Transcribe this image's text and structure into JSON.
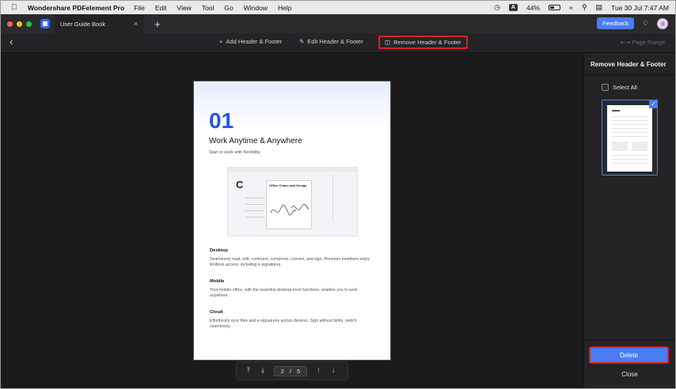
{
  "menubar": {
    "app_name": "Wondershare PDFelement Pro",
    "items": [
      "File",
      "Edit",
      "View",
      "Tool",
      "Go",
      "Window",
      "Help"
    ],
    "input_badge": "A",
    "battery": "44%",
    "datetime": "Tue 30 Jul  7:47 AM"
  },
  "tabbar": {
    "tab_title": "User Guide Book",
    "feedback_label": "Feedback",
    "traffic_colors": [
      "#ff5f57",
      "#febc2e",
      "#28c840"
    ]
  },
  "toolbar": {
    "add_label": "Add Header & Footer",
    "edit_label": "Edit Header & Footer",
    "remove_label": "Remove Header & Footer",
    "page_range_label": "Page Range"
  },
  "document": {
    "chapter_number": "01",
    "title": "Work Anytime & Anywhere",
    "subtitle": "Start to work with flexibility.",
    "screenshot_heading": "Office Chairs and Design",
    "screenshot_letter": "C",
    "sections": [
      {
        "heading": "Desktop",
        "text": "Seamlessly read, edit, comment, compress, convert, and sign. Premium members enjoy limitless access, including e-signatures."
      },
      {
        "heading": "Mobile",
        "text": "Your mobile office, with the essential desktop-level functions, enables you to work anywhere."
      },
      {
        "heading": "Cloud",
        "text": "Effortlessly sync files and e-signatures across devices. Sign without limits, switch seamlessly."
      }
    ]
  },
  "pagination": {
    "current": "2",
    "separator": "/",
    "total": "5"
  },
  "panel": {
    "title": "Remove Header & Footer",
    "select_all_label": "Select All",
    "delete_label": "Delete",
    "close_label": "Close"
  },
  "colors": {
    "accent": "#4a7cf3",
    "highlight_red": "#e02020",
    "chapter_blue": "#2457e6"
  }
}
